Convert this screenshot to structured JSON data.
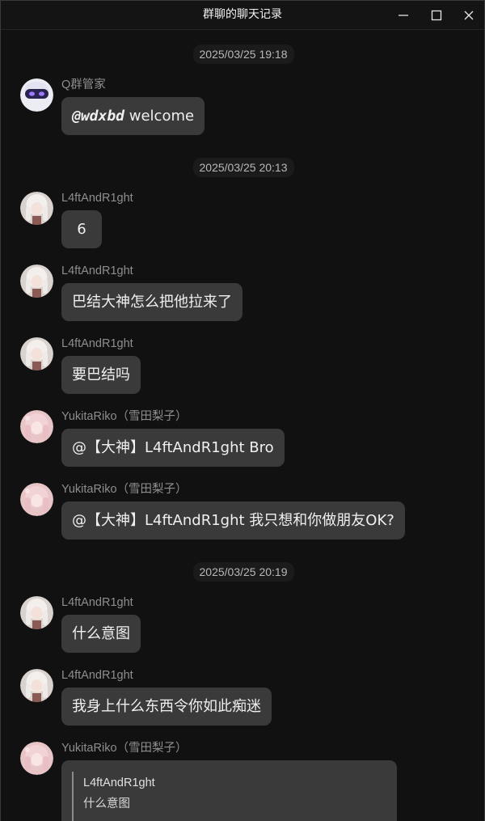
{
  "window": {
    "title": "群聊的聊天记录",
    "controls": {
      "minimize_icon": "minimize-icon",
      "maximize_icon": "maximize-icon",
      "close_icon": "close-icon"
    }
  },
  "colors": {
    "background": "#111111",
    "bubble": "#3a3a3a",
    "sender_text": "#8e8e8e",
    "timestamp_pill": "#1b1b1b"
  },
  "timestamps": [
    "2025/03/25 19:18",
    "2025/03/25 20:13",
    "2025/03/25 20:19"
  ],
  "messages": [
    {
      "sender": "Q群管家",
      "avatar": "robot-avatar",
      "mention": "@wdxbd",
      "text": " welcome"
    },
    {
      "sender": "L4ftAndR1ght",
      "avatar": "white-hair-girl-avatar",
      "text": "6"
    },
    {
      "sender": "L4ftAndR1ght",
      "avatar": "white-hair-girl-avatar",
      "text": "巴结大神怎么把他拉来了"
    },
    {
      "sender": "L4ftAndR1ght",
      "avatar": "white-hair-girl-avatar",
      "text": "要巴结吗"
    },
    {
      "sender": "YukitaRiko（雪田梨子）",
      "avatar": "pink-hair-girl-avatar",
      "text": "@【大神】L4ftAndR1ght Bro"
    },
    {
      "sender": "YukitaRiko（雪田梨子）",
      "avatar": "pink-hair-girl-avatar",
      "text": "@【大神】L4ftAndR1ght 我只想和你做朋友OK?"
    },
    {
      "sender": "L4ftAndR1ght",
      "avatar": "white-hair-girl-avatar",
      "text": "什么意图"
    },
    {
      "sender": "L4ftAndR1ght",
      "avatar": "white-hair-girl-avatar",
      "text": "我身上什么东西令你如此痴迷"
    },
    {
      "sender": "YukitaRiko（雪田梨子）",
      "avatar": "pink-hair-girl-avatar",
      "reply": {
        "author": "L4ftAndR1ght",
        "text": "什么意图"
      }
    }
  ]
}
